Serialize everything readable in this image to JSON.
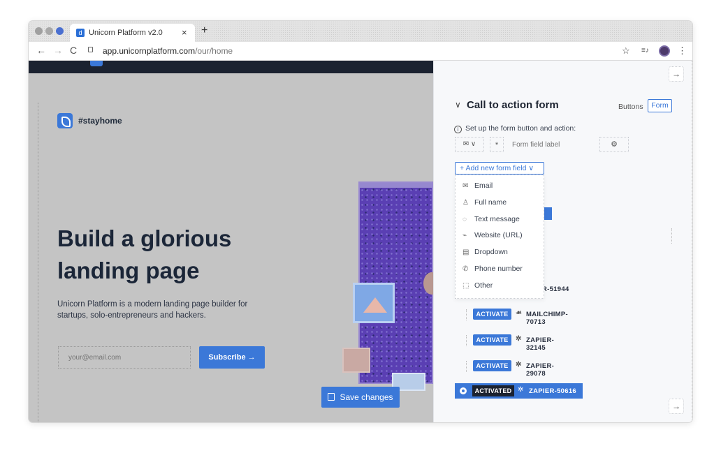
{
  "browser": {
    "tab_title": "Unicorn Platform v2.0",
    "tab_favicon": "d",
    "tab_close": "×",
    "new_tab": "+",
    "url_domain": "app.unicornplatform.com",
    "url_path": "/our/home",
    "back": "←",
    "forward": "→",
    "reload": "C",
    "star": "☆",
    "reading_list": "≡♪",
    "menu": "⋮"
  },
  "canvas": {
    "brand_name": "#stayhome",
    "hero_title": "Build a glorious landing page",
    "hero_subtitle": "Unicorn Platform is a modern landing page builder for startups, solo-entrepreneurs and hackers.",
    "email_placeholder": "your@email.com",
    "subscribe_label": "Subscribe →",
    "save_changes_label": "Save changes"
  },
  "panel": {
    "section_chevron": "∨",
    "section_title": "Call to action form",
    "tab_buttons": "Buttons",
    "tab_form": "Form",
    "hint": "Set up the form button and action:",
    "field_type": "✉ ∨",
    "field_required": "*",
    "field_label_placeholder": "Form field label",
    "field_settings": "⚙",
    "add_field_label": "+ Add new form field ∨",
    "arrow": "→",
    "dropdown_items": [
      {
        "icon": "✉",
        "label": "Email"
      },
      {
        "icon": "♙",
        "label": "Full name"
      },
      {
        "icon": "◌",
        "label": "Text message"
      },
      {
        "icon": "⌁",
        "label": "Website (URL)"
      },
      {
        "icon": "▤",
        "label": "Dropdown"
      },
      {
        "icon": "✆",
        "label": "Phone number"
      },
      {
        "icon": "⬚",
        "label": "Other"
      }
    ],
    "partial_integration": "R-51944",
    "integrations": [
      {
        "button": "ACTIVATE",
        "icon": "☙",
        "name": "MAILCHIMP-70713"
      },
      {
        "button": "ACTIVATE",
        "icon": "✲",
        "name": "ZAPIER-32145"
      },
      {
        "button": "ACTIVATE",
        "icon": "✲",
        "name": "ZAPIER-29078"
      }
    ],
    "active_integration": {
      "button": "ACTIVATED",
      "icon": "✲",
      "name": "ZAPIER-50616"
    }
  },
  "colors": {
    "accent": "#3b78d8",
    "canvas_bg": "#c4c4c4",
    "dark_band": "#1b2230",
    "panel_bg": "#f7f8fa"
  }
}
